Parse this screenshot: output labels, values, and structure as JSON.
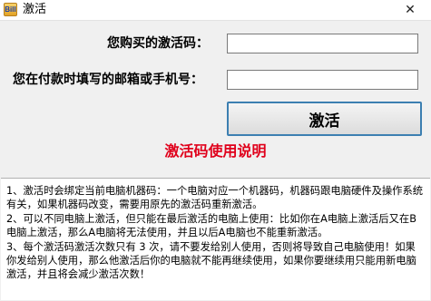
{
  "window": {
    "title": "激活",
    "icon_name": "app-icon",
    "icon_text": "Bill",
    "close_glyph": "✕"
  },
  "form": {
    "code_label": "您购买的激活码：",
    "code_value": "",
    "contact_label": "您在付款时填写的邮箱或手机号：",
    "contact_value": ""
  },
  "activate_button": {
    "label": "激活"
  },
  "instructions": {
    "title": "激活码使用说明",
    "title_color": "#e0001b",
    "lines": [
      "1、激活时会绑定当前电脑机器码：一个电脑对应一个机器码，机器码跟电脑硬件及操作系统有关，如果机器码改变，需要用原先的激活码重新激活。",
      "2、可以不同电脑上激活，但只能在最后激活的电脑上使用：比如你在A电脑上激活后又在B电脑上激活，那么A电脑将无法使用，并且以后A电脑也不能重新激活。",
      "3、每个激活码激活次数只有 3 次，请不要发给别人使用，否则将导致自己电脑使用！如果你发给别人使用，那么他激活后你的电脑就不能再继续使用，如果你要继续用只能用新电脑激活，并且将会减少激活次数！"
    ]
  }
}
